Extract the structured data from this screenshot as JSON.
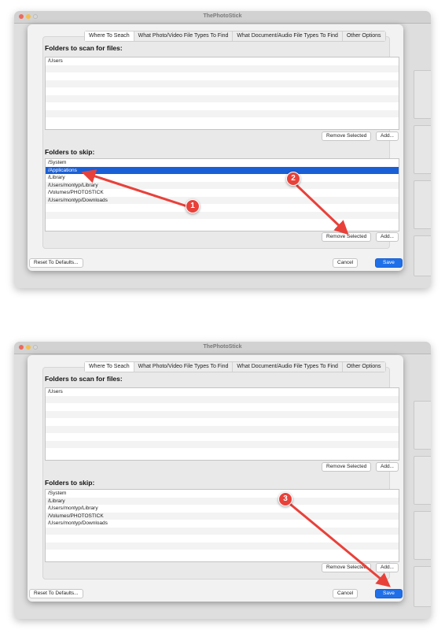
{
  "window": {
    "title": "ThePhotoStick"
  },
  "tabs": [
    {
      "label": "Where To Seach"
    },
    {
      "label": "What Photo/Video File Types To Find"
    },
    {
      "label": "What Document/Audio File Types To Find"
    },
    {
      "label": "Other Options"
    }
  ],
  "scan": {
    "label": "Folders to scan for files:",
    "items": [
      "/Users"
    ]
  },
  "skip": {
    "label": "Folders to skip:"
  },
  "before": {
    "skip_items": [
      "/System",
      "/Applications",
      "/Library",
      "/Users/montyp/Library",
      "/Volumes/PHOTOSTICK",
      "/Users/montyp/Downloads"
    ],
    "selected_item": "/Applications"
  },
  "after": {
    "skip_items": [
      "/System",
      "/Library",
      "/Users/montyp/Library",
      "/Volumes/PHOTOSTICK",
      "/Users/montyp/Downloads"
    ]
  },
  "buttons": {
    "remove_selected": "Remove Selected",
    "add": "Add...",
    "reset": "Reset To Defaults...",
    "cancel": "Cancel",
    "save": "Save"
  },
  "callouts": [
    "1",
    "2",
    "3"
  ],
  "colors": {
    "selection": "#1a5fd6",
    "save_button": "#1f6fe8",
    "callout": "#e8413a",
    "arrow": "#e8413a"
  }
}
